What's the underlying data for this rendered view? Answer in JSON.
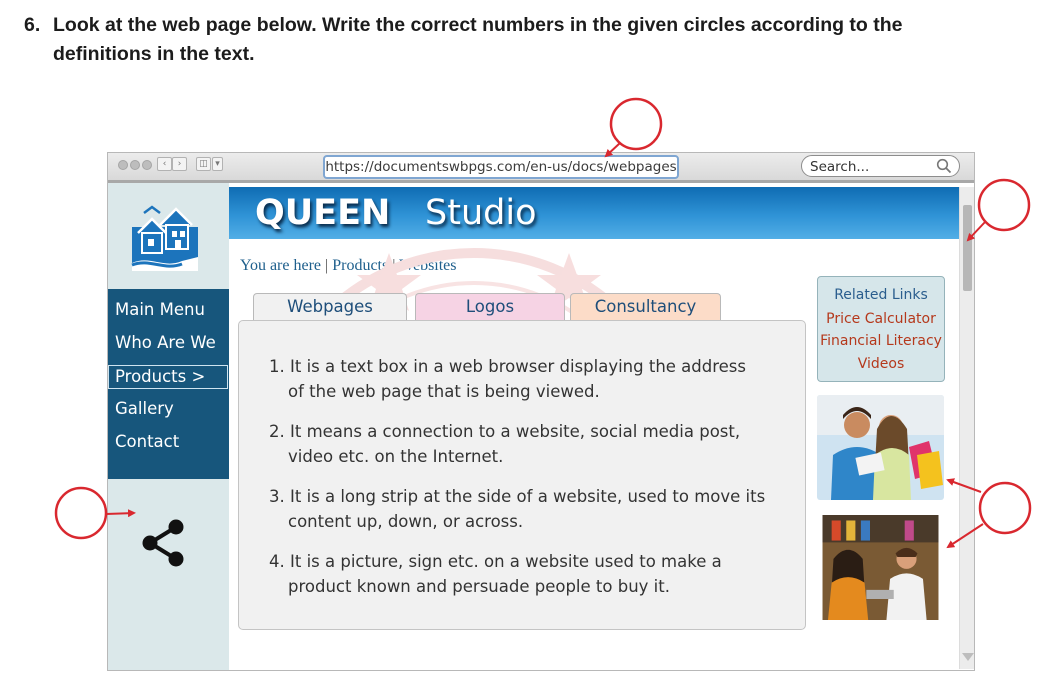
{
  "question": {
    "number": "6.",
    "text": "Look at the web page below. Write the correct numbers in the given circles according to the definitions in the text."
  },
  "browser": {
    "url": "https://documentswbpgs.com/en-us/docs/webpages",
    "search_placeholder": "Search..."
  },
  "site": {
    "brand_bold": "QUEEN",
    "brand_regular": "Studio",
    "menu": [
      "Main Menu",
      "Who Are We",
      "Products >",
      "Gallery",
      "Contact"
    ],
    "breadcrumb": [
      "You are here",
      "Products",
      "Websites"
    ],
    "breadcrumb_separator": "|",
    "tabs": [
      "Webpages",
      "Logos",
      "Consultancy"
    ],
    "definitions": [
      {
        "line1": "1. It is a text box in a web browser displaying the address",
        "line2": "of the web page that is being viewed."
      },
      {
        "line1": "2. It means a connection to a website, social media post,",
        "line2": "video etc. on the Internet."
      },
      {
        "line1": "3. It is a long strip at the side of a website, used to move its",
        "line2": "content up, down, or across."
      },
      {
        "line1": "4. It is a picture, sign etc. on a website used to make a",
        "line2": "product known and persuade people to buy it."
      }
    ],
    "related_links": {
      "heading": "Related Links",
      "items": [
        "Price Calculator",
        "Financial Literacy",
        "Videos"
      ]
    }
  },
  "colors": {
    "menu_bg": "#17567c",
    "sidebar_bg": "#dbe8ea",
    "banner": "#1f7fc6",
    "callout": "#d9282f",
    "tab_webpages": "#f1f1f1",
    "tab_logos": "#f6d3e4",
    "tab_consultancy": "#fcdcc8",
    "link_red": "#b5391c"
  },
  "icons": [
    "house-logo-icon",
    "share-icon",
    "search-icon"
  ]
}
